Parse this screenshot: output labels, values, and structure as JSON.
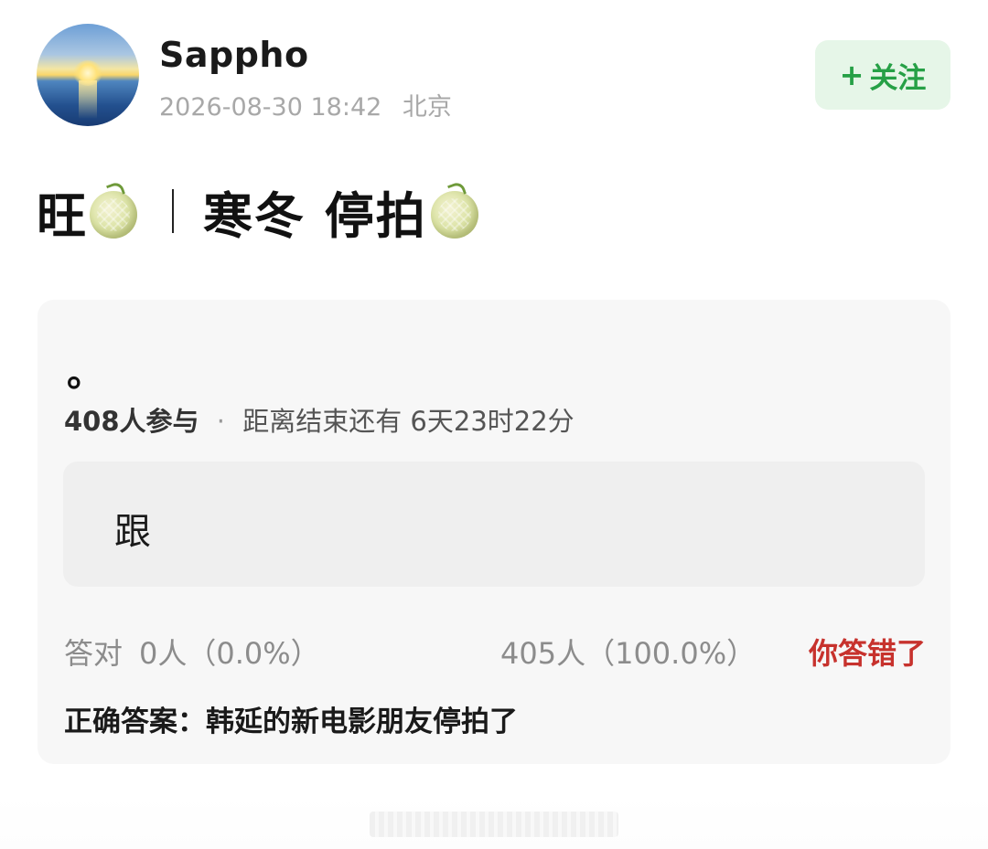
{
  "post": {
    "author": "Sappho",
    "timestamp": "2026-08-30 18:42",
    "location": "北京",
    "follow_label": "关注",
    "follow_icon": "+"
  },
  "title": {
    "part1": "旺",
    "part2": "寒冬 停拍",
    "emoji": "melon-icon"
  },
  "quiz": {
    "question": "。",
    "participants": "408人参与",
    "separator": "·",
    "countdown": "距离结束还有 6天23时22分",
    "option_label": "跟",
    "correct_label": "答对",
    "correct_value": "0人（0.0%）",
    "option_result": "405人（100.0%）",
    "verdict": "你答错了",
    "answer": "正确答案：韩延的新电影朋友停拍了"
  },
  "colors": {
    "follow_green": "#26a046",
    "verdict_red": "#c7322d",
    "card_bg": "#f7f7f7"
  }
}
